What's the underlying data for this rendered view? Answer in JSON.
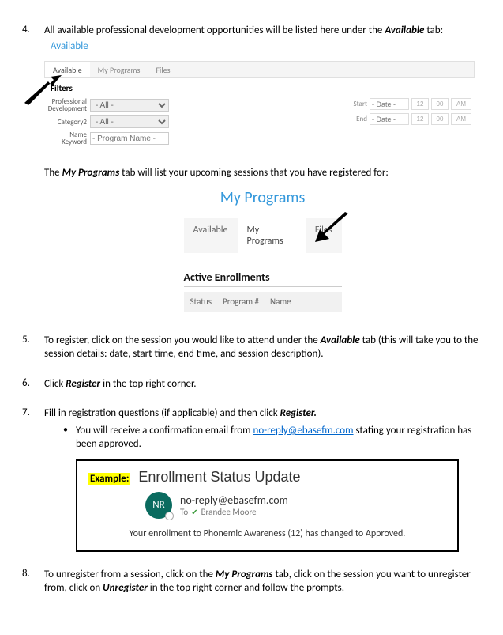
{
  "steps": {
    "s4": {
      "num": "4.",
      "text_a": "All available professional development opportunities will be listed here under the ",
      "text_b": "Available",
      "text_c": " tab:"
    },
    "s5": {
      "num": "5.",
      "text_a": "To register, click on the session you would like to attend under the ",
      "text_b": "Available",
      "text_c": " tab (this will take you to the session details: date, start time, end time, and session description)."
    },
    "s6": {
      "num": "6.",
      "text_a": "Click ",
      "text_b": "Register",
      "text_c": " in the top right corner."
    },
    "s7": {
      "num": "7.",
      "text_a": "Fill in registration questions (if applicable) and then click ",
      "text_b": "Register.",
      "bullet_a": "You will receive a confirmation email from ",
      "bullet_link": "no-reply@ebasefm.com",
      "bullet_b": " stating your registration has been approved."
    },
    "s8": {
      "num": "8.",
      "text_a": "To unregister from a session, click on the ",
      "text_b": "My Programs",
      "text_c": " tab, click on the session you want to unregister from, click on ",
      "text_d": "Unregister",
      "text_e": " in the top right corner and follow the prompts."
    }
  },
  "available_link": "Available",
  "tabs1": {
    "available": "Available",
    "myprograms": "My Programs",
    "files": "Files"
  },
  "filters": {
    "heading": "Filters",
    "labels": {
      "pd": "Professional Development",
      "cat2": "Category2",
      "kw": "Name Keyword"
    },
    "values": {
      "all": "- All -",
      "pn": "- Program Name -"
    },
    "dt": {
      "start": "Start",
      "end": "End",
      "date": "- Date -",
      "h": "12",
      "m": "00",
      "ampm": "AM"
    }
  },
  "midtext": {
    "a": "The ",
    "b": "My Programs",
    "c": " tab will list your upcoming sessions that you have registered for:"
  },
  "shot2": {
    "title": "My Programs",
    "tabs": {
      "available": "Available",
      "myprograms": "My Programs",
      "files": "Files"
    },
    "ae_title": "Active Enrollments",
    "ae_cols": {
      "status": "Status",
      "prog": "Program #",
      "name": "Name"
    }
  },
  "example": {
    "label": "Example:",
    "title": "Enrollment Status Update",
    "avatar": "NR",
    "from": "no-reply@ebasefm.com",
    "to_lbl": "To",
    "to_name": "Brandee Moore",
    "body": "Your enrollment to Phonemic Awareness (12) has changed to Approved."
  }
}
